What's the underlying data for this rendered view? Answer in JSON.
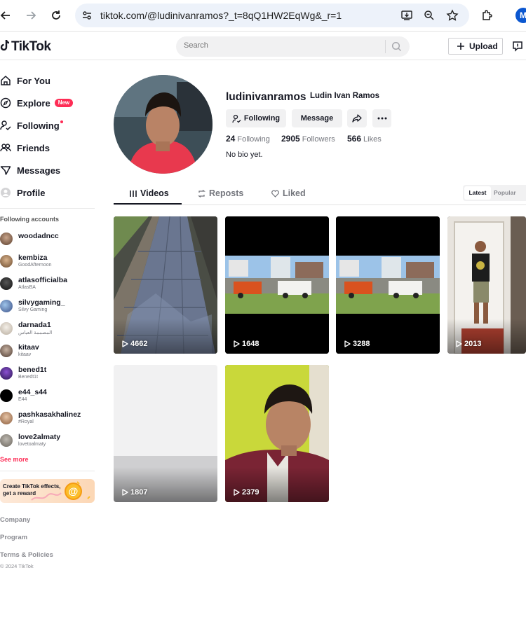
{
  "browser": {
    "url": "tiktok.com/@ludinivanramos?_t=8qQ1HW2EqWg&_r=1",
    "profile_initial": "M"
  },
  "header": {
    "logo": "TikTok",
    "search_placeholder": "Search",
    "upload_label": "Upload"
  },
  "sidebar": {
    "nav": [
      {
        "label": "For You",
        "icon": "home-icon"
      },
      {
        "label": "Explore",
        "icon": "compass-icon",
        "badge": "New"
      },
      {
        "label": "Following",
        "icon": "following-icon"
      },
      {
        "label": "Friends",
        "icon": "friends-icon"
      },
      {
        "label": "Messages",
        "icon": "messages-icon"
      },
      {
        "label": "Profile",
        "icon": "profile-icon"
      }
    ],
    "following_heading": "Following accounts",
    "accounts": [
      {
        "name": "woodadncc",
        "sub": ""
      },
      {
        "name": "kembiza",
        "sub": "GoodAfternoon"
      },
      {
        "name": "atlasofficialba",
        "sub": "AtlasBA"
      },
      {
        "name": "silvygaming_",
        "sub": "Silvy Gaming"
      },
      {
        "name": "darnada1",
        "sub": "المصممة العباس"
      },
      {
        "name": "kitaav",
        "sub": "kitaav"
      },
      {
        "name": "bened1t",
        "sub": "Benedt1t"
      },
      {
        "name": "e44_s44",
        "sub": "E44"
      },
      {
        "name": "pashkasakhalinez",
        "sub": "#Royal"
      },
      {
        "name": "love2almaty",
        "sub": "lovetoalmaty"
      }
    ],
    "see_more": "See more",
    "effects_text": "Create TikTok effects, get a reward",
    "footer": {
      "company": "Company",
      "program": "Program",
      "terms": "Terms & Policies",
      "copyright": "© 2024 TikTok"
    }
  },
  "profile": {
    "username": "ludinivanramos",
    "nickname": "Ludin Ivan Ramos",
    "following_button": "Following",
    "message_button": "Message",
    "following_count": "24",
    "following_label": "Following",
    "followers_count": "2905",
    "followers_label": "Followers",
    "likes_count": "566",
    "likes_label": "Likes",
    "bio": "No bio yet."
  },
  "tabs": {
    "videos": "Videos",
    "reposts": "Reposts",
    "liked": "Liked",
    "sort_latest": "Latest",
    "sort_popular": "Popular"
  },
  "videos": [
    {
      "views": "4662"
    },
    {
      "views": "1648"
    },
    {
      "views": "3288"
    },
    {
      "views": "2013"
    },
    {
      "views": "1807"
    },
    {
      "views": "2379"
    }
  ],
  "colors": {
    "brand_red": "#fe2c55",
    "text_primary": "#161823",
    "text_secondary": "#73757c"
  }
}
